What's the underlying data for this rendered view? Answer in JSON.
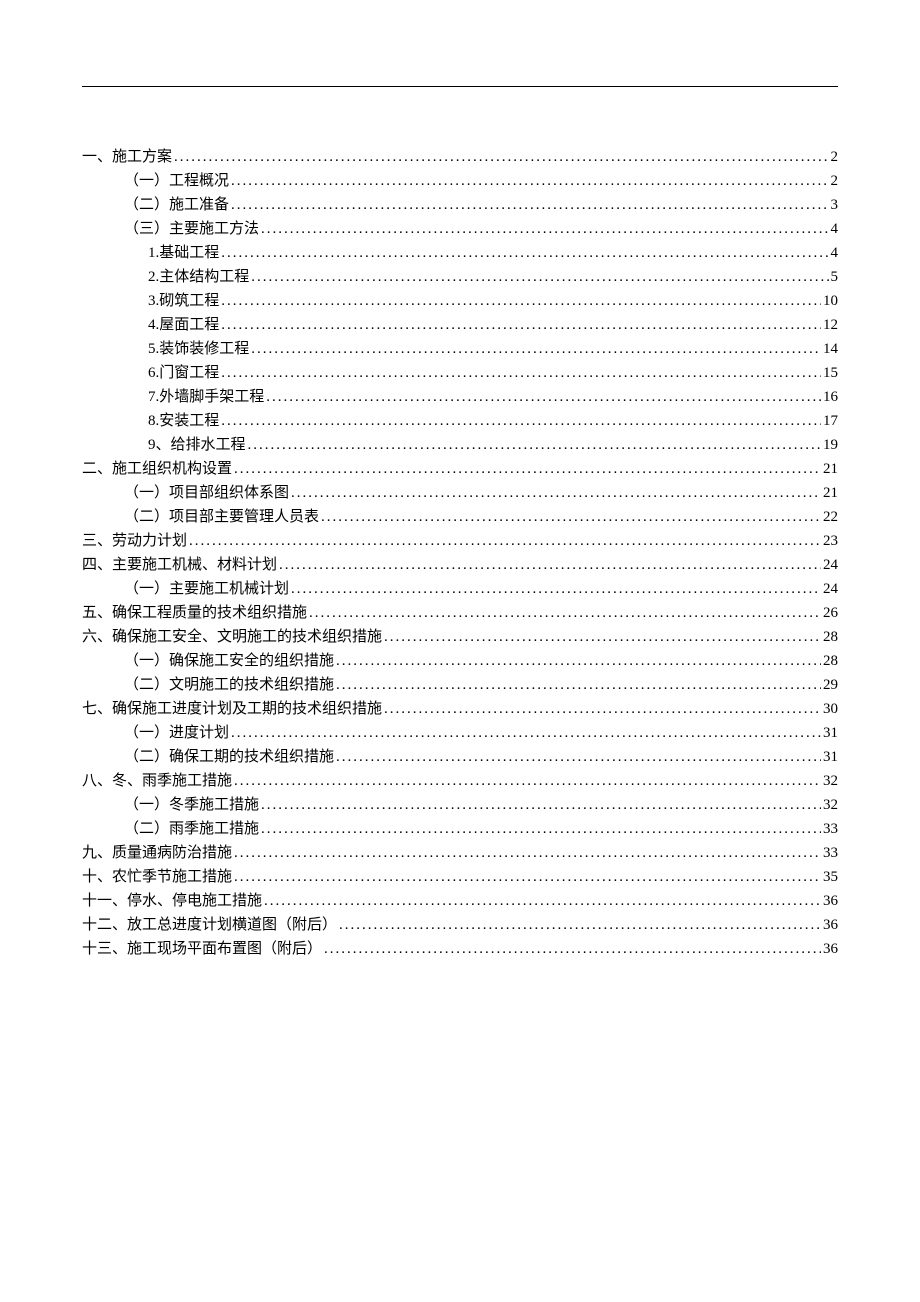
{
  "toc": [
    {
      "level": 1,
      "title": "一、施工方案",
      "page": "2"
    },
    {
      "level": 2,
      "title": "（一）工程概况",
      "page": "2"
    },
    {
      "level": 2,
      "title": "（二）施工准备",
      "page": "3"
    },
    {
      "level": 2,
      "title": "（三）主要施工方法",
      "page": "4"
    },
    {
      "level": 3,
      "title": "1.基础工程",
      "page": "4"
    },
    {
      "level": 3,
      "title": "2.主体结构工程",
      "page": "5"
    },
    {
      "level": 3,
      "title": "3.砌筑工程",
      "page": "10"
    },
    {
      "level": 3,
      "title": "4.屋面工程",
      "page": "12"
    },
    {
      "level": 3,
      "title": "5.装饰装修工程",
      "page": "14"
    },
    {
      "level": 3,
      "title": "6.门窗工程",
      "page": "15"
    },
    {
      "level": 3,
      "title": "7.外墙脚手架工程",
      "page": "16"
    },
    {
      "level": 3,
      "title": "8.安装工程",
      "page": "17"
    },
    {
      "level": 3,
      "title": "9、给排水工程",
      "page": "19"
    },
    {
      "level": 1,
      "title": "二、施工组织机构设置",
      "page": "21"
    },
    {
      "level": 2,
      "title": "（一）项目部组织体系图",
      "page": "21"
    },
    {
      "level": 2,
      "title": "（二）项目部主要管理人员表",
      "page": "22"
    },
    {
      "level": 1,
      "title": "三、劳动力计划",
      "page": "23"
    },
    {
      "level": 1,
      "title": "四、主要施工机械、材料计划",
      "page": "24"
    },
    {
      "level": 2,
      "title": "（一）主要施工机械计划",
      "page": "24"
    },
    {
      "level": 1,
      "title": "五、确保工程质量的技术组织措施",
      "page": "26"
    },
    {
      "level": 1,
      "title": "六、确保施工安全、文明施工的技术组织措施",
      "page": "28"
    },
    {
      "level": 2,
      "title": "（一）确保施工安全的组织措施",
      "page": "28"
    },
    {
      "level": 2,
      "title": "（二）文明施工的技术组织措施",
      "page": "29"
    },
    {
      "level": 1,
      "title": "七、确保施工进度计划及工期的技术组织措施",
      "page": "30"
    },
    {
      "level": 2,
      "title": "（一）进度计划",
      "page": "31"
    },
    {
      "level": 2,
      "title": "（二）确保工期的技术组织措施",
      "page": "31"
    },
    {
      "level": 1,
      "title": "八、冬、雨季施工措施",
      "page": "32"
    },
    {
      "level": 2,
      "title": "（一）冬季施工措施",
      "page": "32"
    },
    {
      "level": 2,
      "title": "（二）雨季施工措施",
      "page": "33"
    },
    {
      "level": 1,
      "title": "九、质量通病防治措施",
      "page": "33"
    },
    {
      "level": 1,
      "title": "十、农忙季节施工措施",
      "page": "35"
    },
    {
      "level": 1,
      "title": "十一、停水、停电施工措施",
      "page": "36"
    },
    {
      "level": 1,
      "title": "十二、放工总进度计划横道图（附后）",
      "page": "36"
    },
    {
      "level": 1,
      "title": "十三、施工现场平面布置图（附后）",
      "page": "36"
    }
  ]
}
